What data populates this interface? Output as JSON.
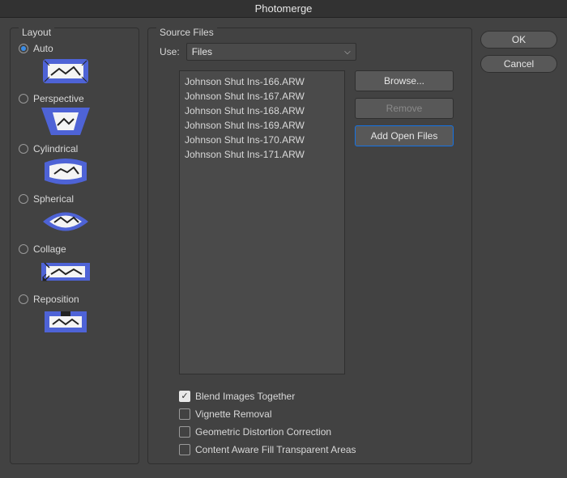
{
  "title": "Photomerge",
  "actions": {
    "ok": "OK",
    "cancel": "Cancel"
  },
  "layout": {
    "legend": "Layout",
    "options": [
      {
        "label": "Auto",
        "checked": true,
        "icon": "auto"
      },
      {
        "label": "Perspective",
        "checked": false,
        "icon": "perspective"
      },
      {
        "label": "Cylindrical",
        "checked": false,
        "icon": "cylindrical"
      },
      {
        "label": "Spherical",
        "checked": false,
        "icon": "spherical"
      },
      {
        "label": "Collage",
        "checked": false,
        "icon": "collage"
      },
      {
        "label": "Reposition",
        "checked": false,
        "icon": "reposition"
      }
    ]
  },
  "source": {
    "legend": "Source Files",
    "use_label": "Use:",
    "use_value": "Files",
    "files": [
      "Johnson Shut Ins-166.ARW",
      "Johnson Shut Ins-167.ARW",
      "Johnson Shut Ins-168.ARW",
      "Johnson Shut Ins-169.ARW",
      "Johnson Shut Ins-170.ARW",
      "Johnson Shut Ins-171.ARW"
    ],
    "buttons": {
      "browse": "Browse...",
      "remove": "Remove",
      "add_open": "Add Open Files"
    },
    "checks": [
      {
        "label": "Blend Images Together",
        "checked": true
      },
      {
        "label": "Vignette Removal",
        "checked": false
      },
      {
        "label": "Geometric Distortion Correction",
        "checked": false
      },
      {
        "label": "Content Aware Fill Transparent Areas",
        "checked": false
      }
    ]
  }
}
